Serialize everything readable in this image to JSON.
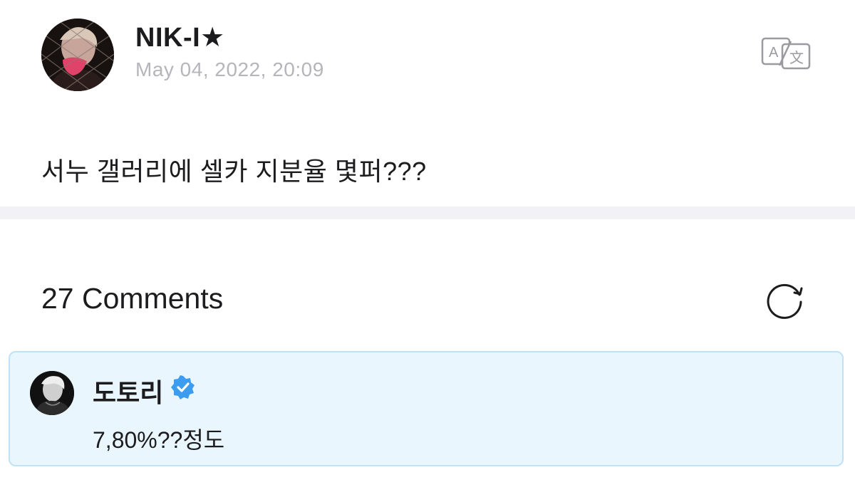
{
  "post": {
    "author": "NIK-I★",
    "date": "May 04, 2022, 20:09",
    "body": "서누 갤러리에 셀카 지분율 몇퍼???",
    "translate_icon": "translate-icon"
  },
  "comments": {
    "count_label": "27 Comments",
    "refresh_icon": "refresh-icon",
    "items": [
      {
        "name": "도토리",
        "verified": true,
        "text": "7,80%??정도"
      }
    ]
  },
  "colors": {
    "highlight_bg": "#eaf6fd",
    "highlight_border": "#bfe2f6",
    "verified_blue": "#3b9cf0",
    "date_gray": "#b5b5bb",
    "separator": "#f2f2f6"
  }
}
